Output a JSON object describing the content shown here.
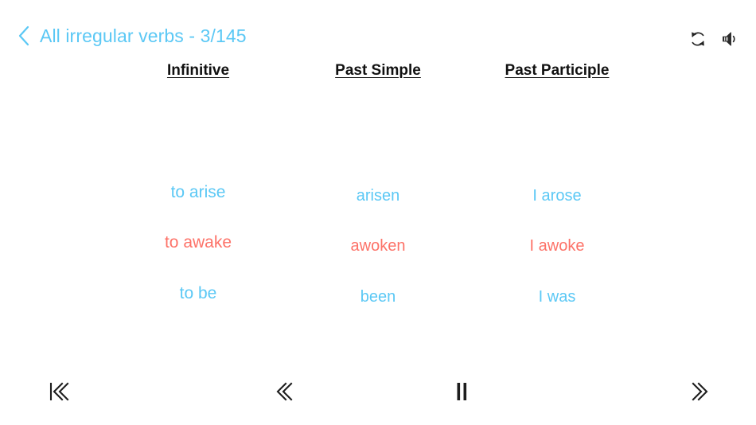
{
  "header": {
    "back_icon": "chevron-left-icon",
    "title": "All irregular verbs - 3/145",
    "accent_color": "#5BC8F5",
    "actions": [
      {
        "icon": "refresh-icon",
        "label": "Repeat"
      },
      {
        "icon": "speaker-icon",
        "label": "Sound"
      }
    ]
  },
  "table": {
    "columns": [
      {
        "label": "Infinitive"
      },
      {
        "label": "Past Simple"
      },
      {
        "label": "Past Participle"
      }
    ],
    "rows": [
      {
        "tone": "blue",
        "color": "#5BC8F5",
        "infinitive": "to arise",
        "past_simple": "arisen",
        "past_participle": "I arose"
      },
      {
        "tone": "red",
        "color": "#FD7268",
        "infinitive": "to awake",
        "past_simple": "awoken",
        "past_participle": "I awoke"
      },
      {
        "tone": "blue",
        "color": "#5BC8F5",
        "infinitive": "to be",
        "past_simple": "been",
        "past_participle": "I was"
      }
    ]
  },
  "transport": {
    "first": {
      "icon": "skip-to-start-icon",
      "label": "First"
    },
    "previous": {
      "icon": "chevron-double-left-icon",
      "label": "Previous"
    },
    "play_pause": {
      "icon": "pause-icon",
      "label": "Pause"
    },
    "next": {
      "icon": "chevron-double-right-icon",
      "label": "Next"
    }
  }
}
